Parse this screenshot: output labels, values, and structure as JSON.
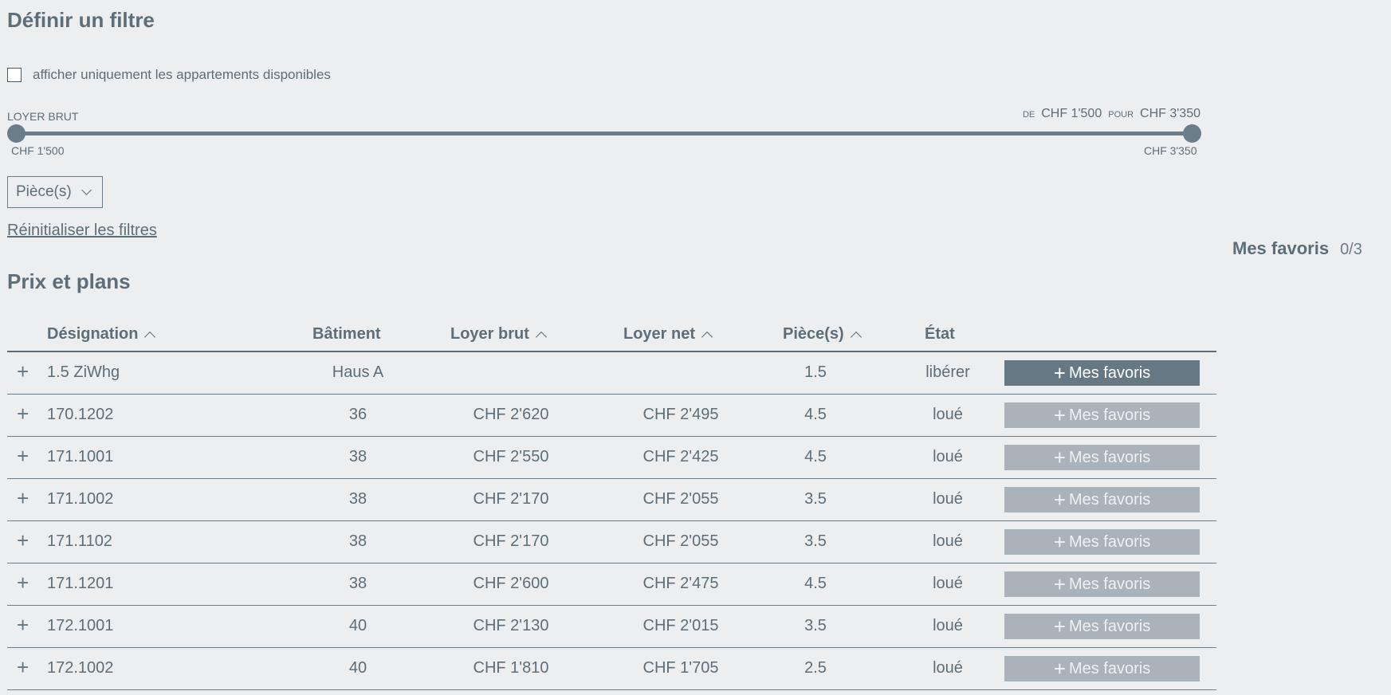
{
  "filter": {
    "title": "Définir un filtre",
    "available_only_label": "afficher uniquement les appartements disponibles",
    "rent_label": "Loyer brut",
    "range_from_word": "de",
    "range_from_value": "CHF 1'500",
    "range_to_word": "pour",
    "range_to_value": "CHF 3'350",
    "slider_min_label": "CHF 1'500",
    "slider_max_label": "CHF 3'350",
    "rooms_select": "Pièce(s)",
    "reset_link": "Réinitialiser les filtres"
  },
  "favorites": {
    "title": "Mes favoris",
    "count": "0/3"
  },
  "prices": {
    "title": "Prix et plans",
    "columns": {
      "designation": "Désignation",
      "building": "Bâtiment",
      "gross_rent": "Loyer brut",
      "net_rent": "Loyer net",
      "rooms": "Pièce(s)",
      "status": "État"
    },
    "fav_button_label": "Mes favoris",
    "rows": [
      {
        "designation": "1.5 ZiWhg",
        "building": "Haus A",
        "gross_rent": "",
        "net_rent": "",
        "rooms": "1.5",
        "status": "libérer"
      },
      {
        "designation": "170.1202",
        "building": "36",
        "gross_rent": "CHF 2'620",
        "net_rent": "CHF 2'495",
        "rooms": "4.5",
        "status": "loué"
      },
      {
        "designation": "171.1001",
        "building": "38",
        "gross_rent": "CHF 2'550",
        "net_rent": "CHF 2'425",
        "rooms": "4.5",
        "status": "loué"
      },
      {
        "designation": "171.1002",
        "building": "38",
        "gross_rent": "CHF 2'170",
        "net_rent": "CHF 2'055",
        "rooms": "3.5",
        "status": "loué"
      },
      {
        "designation": "171.1102",
        "building": "38",
        "gross_rent": "CHF 2'170",
        "net_rent": "CHF 2'055",
        "rooms": "3.5",
        "status": "loué"
      },
      {
        "designation": "171.1201",
        "building": "38",
        "gross_rent": "CHF 2'600",
        "net_rent": "CHF 2'475",
        "rooms": "4.5",
        "status": "loué"
      },
      {
        "designation": "172.1001",
        "building": "40",
        "gross_rent": "CHF 2'130",
        "net_rent": "CHF 2'015",
        "rooms": "3.5",
        "status": "loué"
      },
      {
        "designation": "172.1002",
        "building": "40",
        "gross_rent": "CHF 1'810",
        "net_rent": "CHF 1'705",
        "rooms": "2.5",
        "status": "loué"
      }
    ]
  }
}
